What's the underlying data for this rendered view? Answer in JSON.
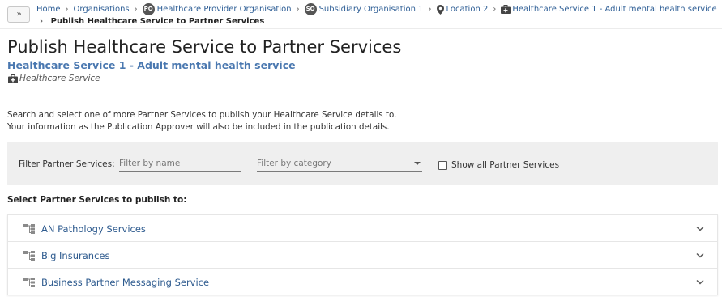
{
  "breadcrumb": {
    "expand_glyph": "»",
    "items": [
      {
        "label": "Home"
      },
      {
        "label": "Organisations"
      },
      {
        "label": "Healthcare Provider Organisation",
        "badge": "PO"
      },
      {
        "label": "Subsidiary Organisation 1",
        "badge": "SO"
      },
      {
        "label": "Location 2",
        "icon": "map-pin-icon"
      },
      {
        "label": "Healthcare Service 1 - Adult mental health service",
        "icon": "medical-bag-icon"
      }
    ],
    "current": "Publish Healthcare Service to Partner Services"
  },
  "header": {
    "title": "Publish Healthcare Service to Partner Services",
    "service_name": "Healthcare Service 1 - Adult mental health service",
    "service_type": "Healthcare Service"
  },
  "intro": {
    "line1": "Search and select one of more Partner Services to publish your Healthcare Service details to.",
    "line2": "Your information as the Publication Approver will also be included in the publication details."
  },
  "filter": {
    "label": "Filter Partner Services:",
    "name_placeholder": "Filter by name",
    "name_value": "",
    "category_placeholder": "Filter by category",
    "show_all_label": "Show all Partner Services",
    "show_all_checked": false
  },
  "select_heading": "Select Partner Services to publish to:",
  "partner_services": [
    {
      "label": "AN Pathology Services",
      "icon": "hierarchy-icon"
    },
    {
      "label": "Big Insurances",
      "icon": "hierarchy-icon"
    },
    {
      "label": "Business Partner Messaging Service",
      "icon": "hierarchy-icon"
    }
  ],
  "colors": {
    "link": "#2f5f96",
    "service_name": "#4a78b0",
    "panel_bg": "#efefef",
    "list_label": "#2d5a8e"
  }
}
